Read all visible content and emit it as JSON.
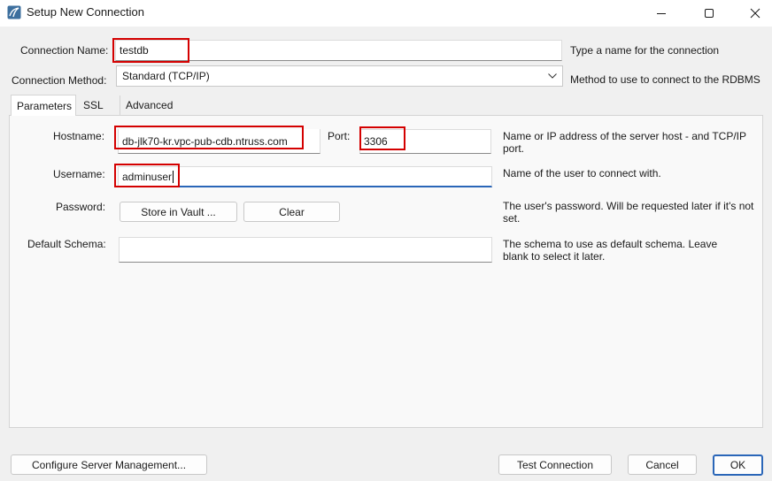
{
  "window": {
    "title": "Setup New Connection",
    "icon": "mysql-workbench-icon",
    "controls": {
      "minimize": "minimize-icon",
      "maximize": "maximize-icon",
      "close": "close-icon"
    }
  },
  "connection": {
    "name_label": "Connection Name:",
    "name_value": "testdb",
    "name_hint": "Type a name for the connection",
    "method_label": "Connection Method:",
    "method_value": "Standard (TCP/IP)",
    "method_hint": "Method to use to connect to the RDBMS"
  },
  "tabs": [
    {
      "label": "Parameters",
      "active": true
    },
    {
      "label": "SSL",
      "active": false
    },
    {
      "label": "Advanced",
      "active": false
    }
  ],
  "parameters": {
    "hostname_label": "Hostname:",
    "hostname_value": "db-jlk70-kr.vpc-pub-cdb.ntruss.com",
    "port_label": "Port:",
    "port_value": "3306",
    "hostname_hint": "Name or IP address of the server host - and TCP/IP port.",
    "username_label": "Username:",
    "username_value": "adminuser",
    "username_hint": "Name of the user to connect with.",
    "password_label": "Password:",
    "store_vault_label": "Store in Vault ...",
    "clear_label": "Clear",
    "password_hint": "The user's password. Will be requested later if it's not set.",
    "schema_label": "Default Schema:",
    "schema_value": "",
    "schema_hint": "The schema to use as default schema. Leave blank to select it later."
  },
  "footer": {
    "configure_label": "Configure Server Management...",
    "test_label": "Test Connection",
    "cancel_label": "Cancel",
    "ok_label": "OK"
  },
  "colors": {
    "highlight_box": "#d40000",
    "focus_accent": "#2a66b8",
    "background": "#f0f0f0"
  }
}
